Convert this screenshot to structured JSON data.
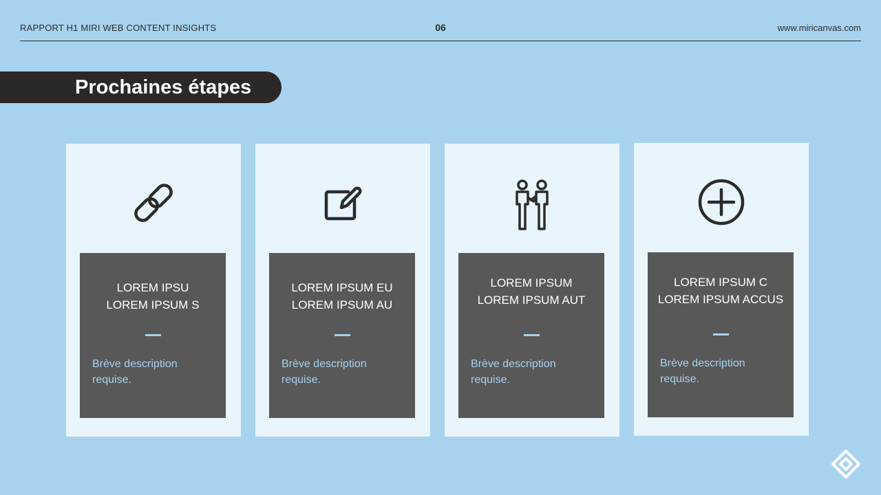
{
  "header": {
    "report_title": "RAPPORT H1 MIRI WEB CONTENT INSIGHTS",
    "page_number": "06",
    "website": "www.miricanvas.com"
  },
  "section_title": "Prochaines étapes",
  "cards": [
    {
      "icon": "link-icon",
      "title_line1": "LOREM IPSU",
      "title_line2": "LOREM IPSUM S",
      "description_line1": "Brève description",
      "description_line2": "requise."
    },
    {
      "icon": "edit-icon",
      "title_line1": "LOREM IPSUM EU",
      "title_line2": "LOREM IPSUM AU",
      "description_line1": "Brève description",
      "description_line2": "requise."
    },
    {
      "icon": "handshake-icon",
      "title_line1": "LOREM IPSUM",
      "title_line2": "LOREM IPSUM AUT",
      "description_line1": "Brève description",
      "description_line2": "requise."
    },
    {
      "icon": "plus-circle-icon",
      "title_line1": "LOREM IPSUM C",
      "title_line2": "LOREM IPSUM ACCUS",
      "description_line1": "Brève description",
      "description_line2": "requise."
    }
  ],
  "colors": {
    "background": "#a7d3ee",
    "card": "#e8f5fd",
    "panel": "#585858",
    "title_pill": "#2b2826",
    "accent": "#a7d3ee"
  },
  "footer": {
    "logo": "miricanvas-logo-icon"
  }
}
